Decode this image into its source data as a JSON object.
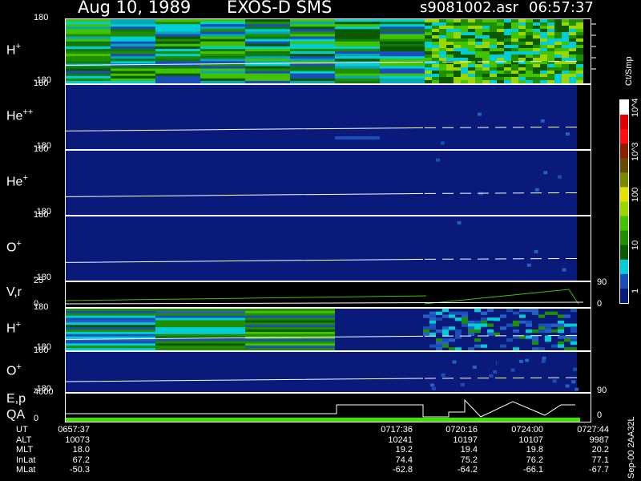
{
  "header": {
    "date": "Aug 10, 1989",
    "mission": "EXOS-D SMS",
    "filename": "s9081002.asr",
    "time": "06:57:37"
  },
  "colorbar": {
    "unit": "Ct/Smp",
    "labels": [
      "10^4",
      "10^3",
      "100",
      "10",
      "1"
    ],
    "colors": [
      "#ffffff",
      "#e00000",
      "#ff1010",
      "#8a2000",
      "#6a4a00",
      "#7a8a00",
      "#e6e000",
      "#9ad600",
      "#43c200",
      "#1f8f00",
      "#0c5a00",
      "#00cdd6",
      "#1a4fb8",
      "#0a1a7a"
    ]
  },
  "chart_data": {
    "type": "heatmap",
    "panels": [
      {
        "id": "h_plus_1",
        "label_base": "H",
        "label_sup": "+",
        "yticks": [
          "180",
          "-180"
        ],
        "style": "hplus_green"
      },
      {
        "id": "he_pp",
        "label_base": "He",
        "label_sup": "++",
        "yticks": [
          "180",
          "-180"
        ],
        "style": "blue"
      },
      {
        "id": "he_p",
        "label_base": "He",
        "label_sup": "+",
        "yticks": [
          "180",
          "-180"
        ],
        "style": "blue"
      },
      {
        "id": "o_plus_1",
        "label_base": "O",
        "label_sup": "+",
        "yticks": [
          "180",
          "-180"
        ],
        "style": "blue"
      },
      {
        "id": "vr",
        "label_base": "V,r",
        "label_sup": "",
        "yticks": [
          "25",
          "0"
        ],
        "right_ticks": [
          "90",
          "0"
        ],
        "style": "line"
      },
      {
        "id": "h_plus_2",
        "label_base": "H",
        "label_sup": "+",
        "yticks": [
          "180",
          "-180"
        ],
        "style": "mixed"
      },
      {
        "id": "o_plus_2",
        "label_base": "O",
        "label_sup": "+",
        "yticks": [
          "180",
          "-180"
        ],
        "right_ticks": [
          "90"
        ],
        "style": "blue_sparse"
      },
      {
        "id": "ep_qa",
        "label_base": "E,p",
        "label_sup": "",
        "label2": "QA",
        "yticks": [
          "4000",
          "0"
        ],
        "right_ticks": [
          "0"
        ],
        "style": "ep"
      }
    ],
    "x_times": [
      "0717:36",
      "0720:16",
      "0724:00",
      "0727:44"
    ],
    "ephemeris": {
      "labels": [
        "UT",
        "ALT",
        "MLT",
        "InLat",
        "MLat"
      ],
      "start": [
        "0657:37",
        "10073",
        "18.0",
        "67.2",
        "-50.3"
      ],
      "columns": [
        [
          "0717:36",
          "10241",
          "19.2",
          "74.4",
          "-62.8"
        ],
        [
          "0720:16",
          "10197",
          "19.4",
          "75.2",
          "-64.2"
        ],
        [
          "0724:00",
          "10107",
          "19.8",
          "76.2",
          "-66.1"
        ],
        [
          "0727:44",
          "9987",
          "20.2",
          "77.1",
          "-67.7"
        ]
      ]
    },
    "footer_note": "Sep-00 2AA32L"
  }
}
